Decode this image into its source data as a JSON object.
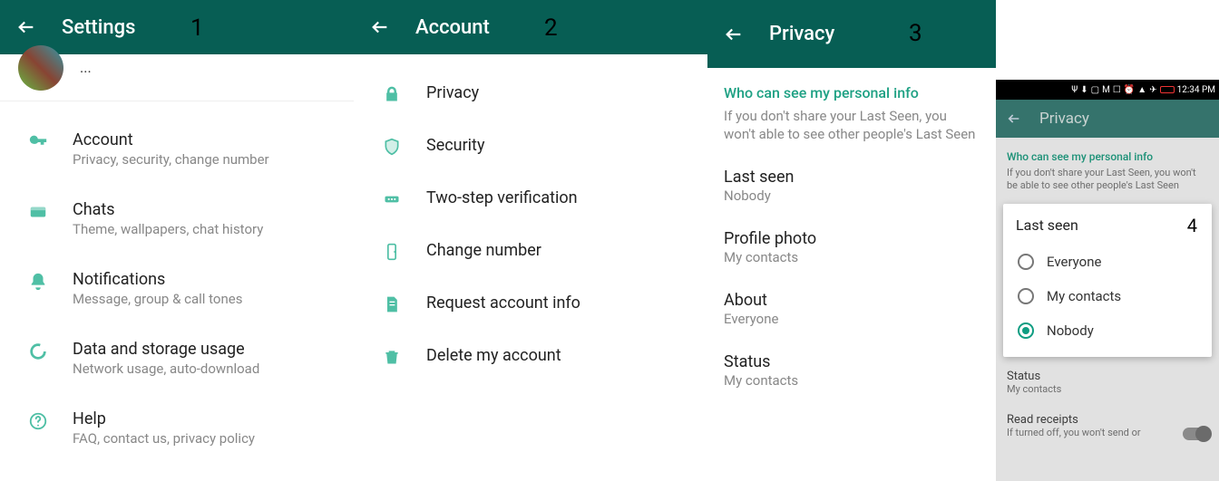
{
  "step_labels": {
    "s1": "1",
    "s2": "2",
    "s3": "3",
    "s4": "4"
  },
  "panel1": {
    "title": "Settings",
    "profile_truncated": "...",
    "items": [
      {
        "title": "Account",
        "sub": "Privacy, security, change number"
      },
      {
        "title": "Chats",
        "sub": "Theme, wallpapers, chat history"
      },
      {
        "title": "Notifications",
        "sub": "Message, group & call tones"
      },
      {
        "title": "Data and storage usage",
        "sub": "Network usage, auto-download"
      },
      {
        "title": "Help",
        "sub": "FAQ, contact us, privacy policy"
      }
    ]
  },
  "panel2": {
    "title": "Account",
    "items": [
      {
        "title": "Privacy"
      },
      {
        "title": "Security"
      },
      {
        "title": "Two-step verification"
      },
      {
        "title": "Change number"
      },
      {
        "title": "Request account info"
      },
      {
        "title": "Delete my account"
      }
    ]
  },
  "panel3": {
    "title": "Privacy",
    "section_head": "Who can see my personal info",
    "section_note": "If you don't share your Last Seen, you won't able to see other people's Last Seen",
    "items": [
      {
        "title": "Last seen",
        "sub": "Nobody"
      },
      {
        "title": "Profile photo",
        "sub": "My contacts"
      },
      {
        "title": "About",
        "sub": "Everyone"
      },
      {
        "title": "Status",
        "sub": "My contacts"
      }
    ]
  },
  "panel4": {
    "time": "12:34 PM",
    "title": "Privacy",
    "section_head": "Who can see my personal info",
    "section_note": "If you don't share your Last Seen, you won't be able to see other people's Last Seen",
    "dialog_title": "Last seen",
    "options": [
      {
        "label": "Everyone",
        "selected": false
      },
      {
        "label": "My contacts",
        "selected": false
      },
      {
        "label": "Nobody",
        "selected": true
      }
    ],
    "below": [
      {
        "title": "Status",
        "sub": "My contacts"
      },
      {
        "title": "Read receipts",
        "sub": "If turned off, you won't send or"
      }
    ]
  }
}
